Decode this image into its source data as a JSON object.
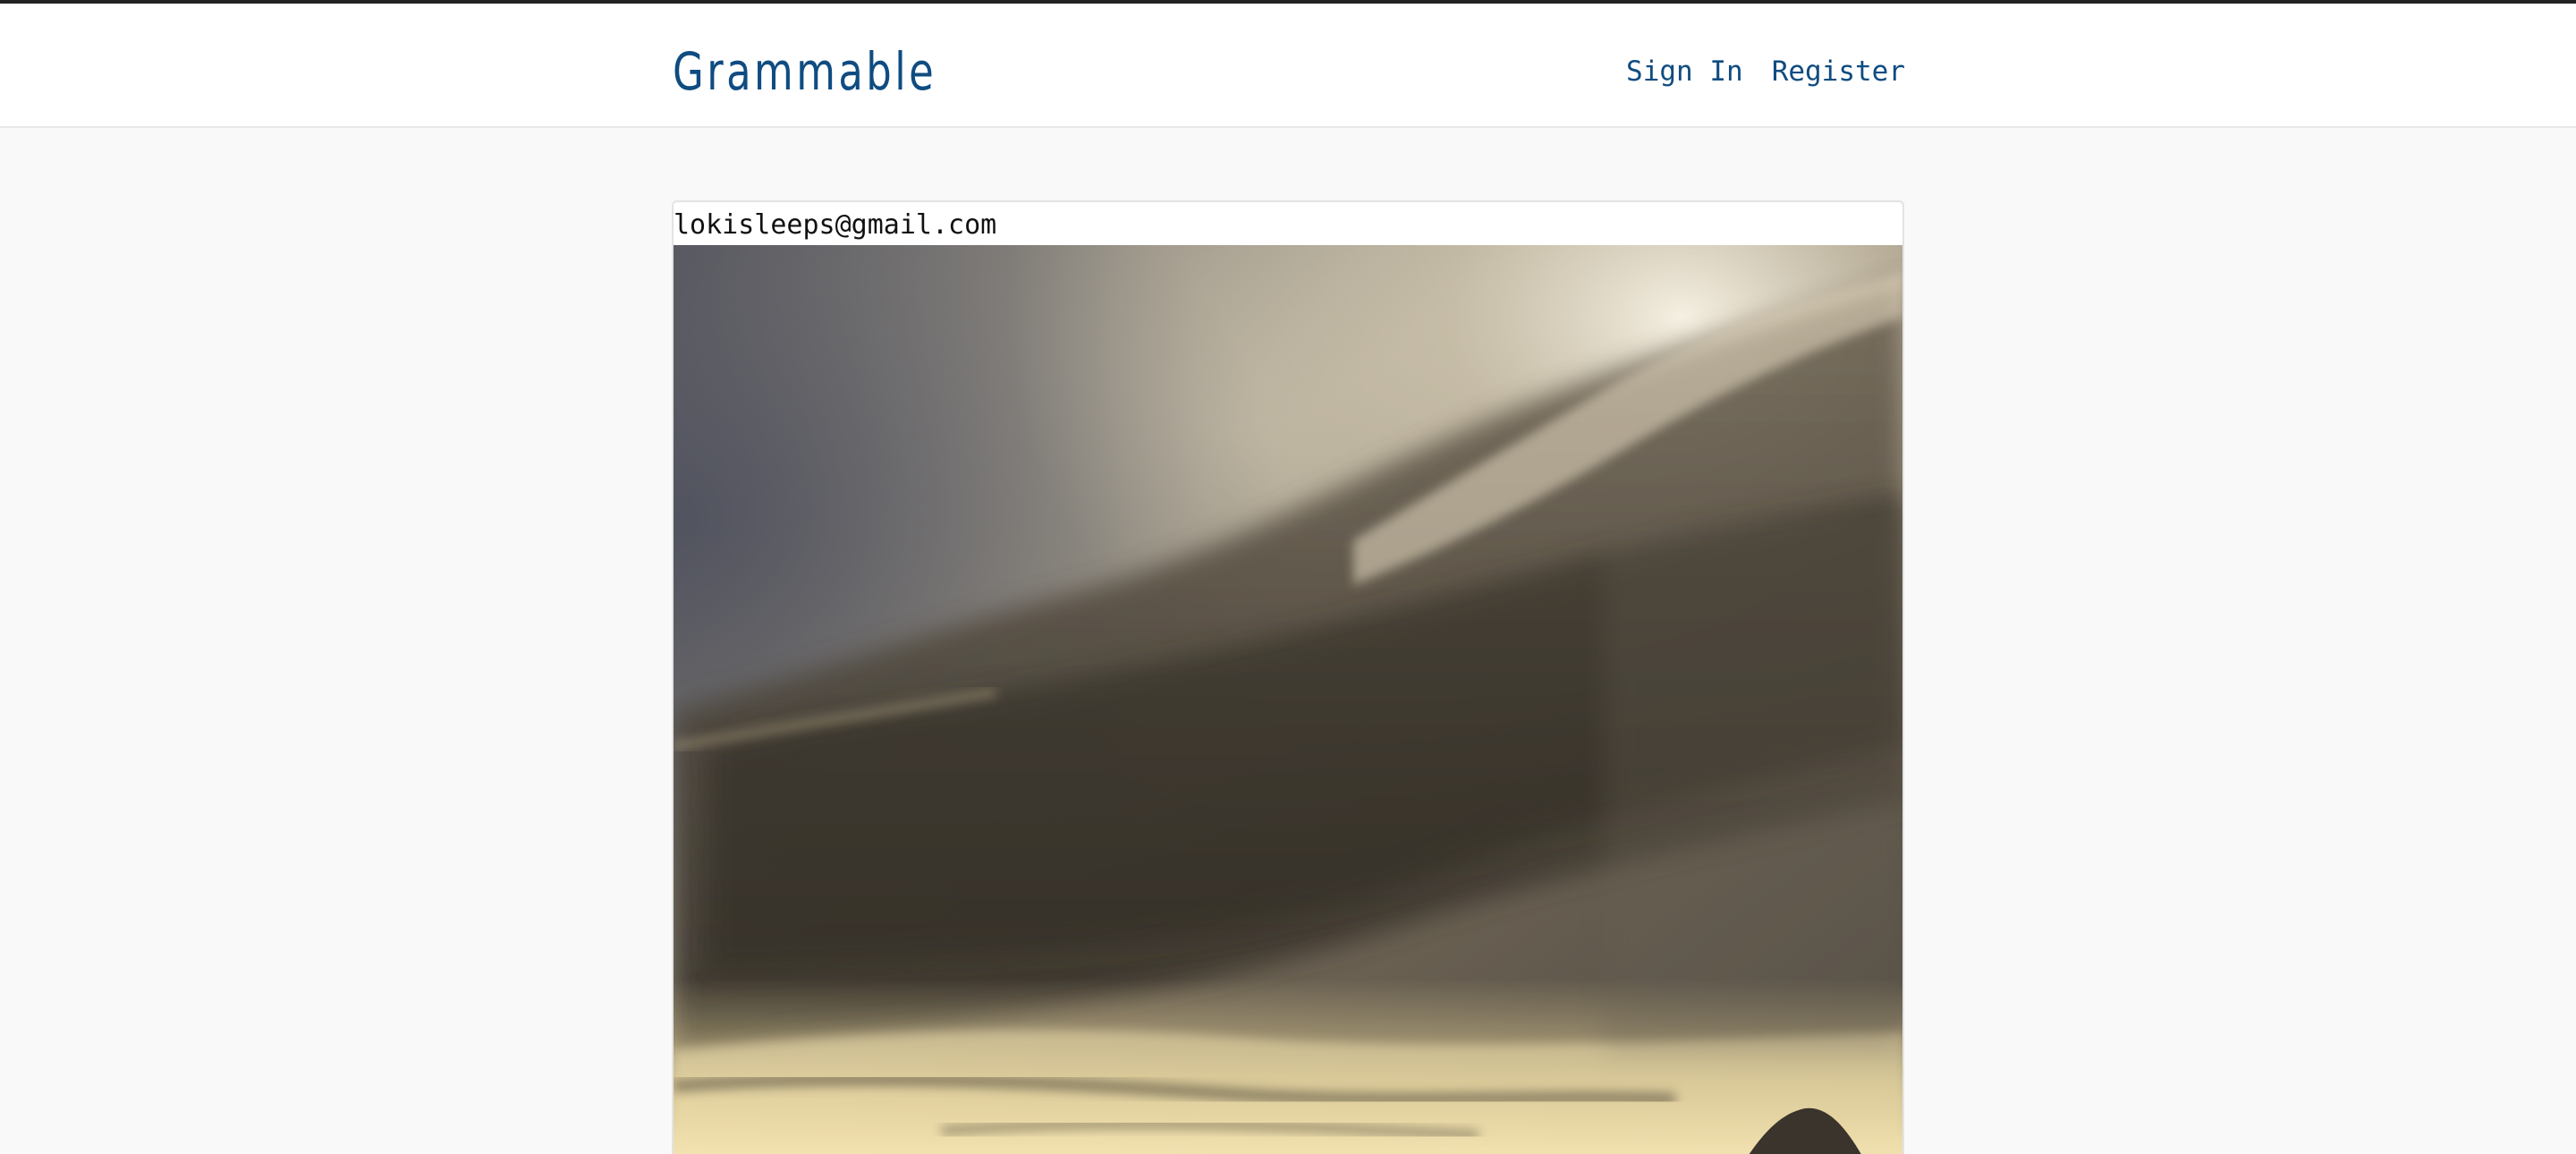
{
  "header": {
    "brand": "Grammable",
    "nav": [
      {
        "label": "Sign In"
      },
      {
        "label": "Register"
      }
    ]
  },
  "feed": {
    "posts": [
      {
        "author": "lokisleeps@gmail.com",
        "image_description": "stormy-sky-photo"
      }
    ]
  },
  "colors": {
    "brand": "#0f4c81",
    "top_border": "#222222",
    "page_background": "#f9f9f9"
  }
}
